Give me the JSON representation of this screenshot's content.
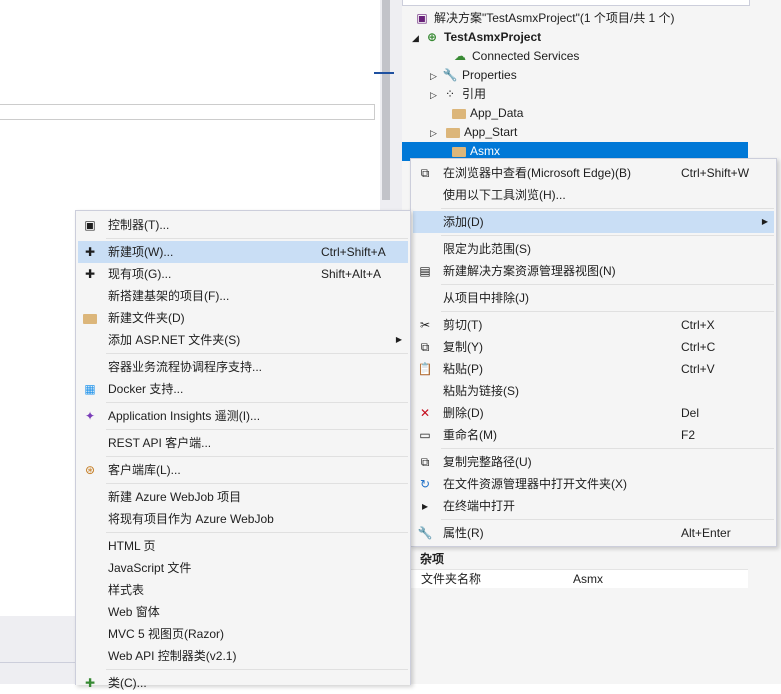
{
  "solution_explorer": {
    "solution_label": "解决方案\"TestAsmxProject\"(1 个项目/共 1 个)",
    "project": "TestAsmxProject",
    "items": [
      {
        "label": "Connected Services"
      },
      {
        "label": "Properties"
      },
      {
        "label": "引用"
      },
      {
        "label": "App_Data"
      },
      {
        "label": "App_Start"
      },
      {
        "label": "Asmx"
      }
    ],
    "props_section": "杂项",
    "props_key": "文件夹名称",
    "props_value": "Asmx"
  },
  "context_menu": {
    "items": [
      {
        "label": "在浏览器中查看(Microsoft Edge)(B)",
        "shortcut": "Ctrl+Shift+W"
      },
      {
        "label": "使用以下工具浏览(H)..."
      },
      {
        "label": "添加(D)"
      },
      {
        "label": "限定为此范围(S)"
      },
      {
        "label": "新建解决方案资源管理器视图(N)"
      },
      {
        "label": "从项目中排除(J)"
      },
      {
        "label": "剪切(T)",
        "shortcut": "Ctrl+X"
      },
      {
        "label": "复制(Y)",
        "shortcut": "Ctrl+C"
      },
      {
        "label": "粘贴(P)",
        "shortcut": "Ctrl+V"
      },
      {
        "label": "粘贴为链接(S)"
      },
      {
        "label": "删除(D)",
        "shortcut": "Del"
      },
      {
        "label": "重命名(M)",
        "shortcut": "F2"
      },
      {
        "label": "复制完整路径(U)"
      },
      {
        "label": "在文件资源管理器中打开文件夹(X)"
      },
      {
        "label": "在终端中打开"
      },
      {
        "label": "属性(R)",
        "shortcut": "Alt+Enter"
      }
    ]
  },
  "add_submenu": {
    "items": [
      {
        "label": "控制器(T)..."
      },
      {
        "label": "新建项(W)...",
        "shortcut": "Ctrl+Shift+A"
      },
      {
        "label": "现有项(G)...",
        "shortcut": "Shift+Alt+A"
      },
      {
        "label": "新搭建基架的项目(F)..."
      },
      {
        "label": "新建文件夹(D)"
      },
      {
        "label": "添加 ASP.NET 文件夹(S)"
      },
      {
        "label": "容器业务流程协调程序支持..."
      },
      {
        "label": "Docker 支持..."
      },
      {
        "label": "Application Insights 遥测(I)..."
      },
      {
        "label": "REST API 客户端..."
      },
      {
        "label": "客户端库(L)..."
      },
      {
        "label": "新建 Azure WebJob 项目"
      },
      {
        "label": "将现有项目作为 Azure WebJob"
      },
      {
        "label": "HTML 页"
      },
      {
        "label": "JavaScript 文件"
      },
      {
        "label": "样式表"
      },
      {
        "label": "Web 窗体"
      },
      {
        "label": "MVC 5 视图页(Razor)"
      },
      {
        "label": "Web API 控制器类(v2.1)"
      },
      {
        "label": "类(C)..."
      }
    ]
  },
  "colors": {
    "selection": "#0078d7",
    "menu_highlight": "#c9def5",
    "menu_bg": "#f5f5f5"
  }
}
